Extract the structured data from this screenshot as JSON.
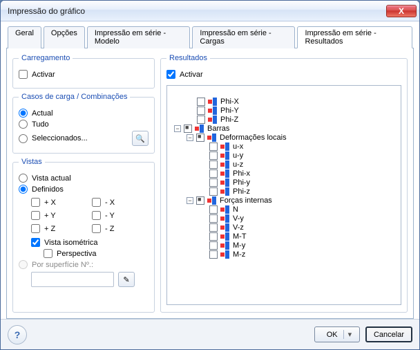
{
  "window": {
    "title": "Impressão do gráfico"
  },
  "close_icon": "X",
  "tabs": [
    {
      "label": "Geral"
    },
    {
      "label": "Opções"
    },
    {
      "label": "Impressão em série - Modelo"
    },
    {
      "label": "Impressão em série - Cargas"
    },
    {
      "label": "Impressão em série - Resultados"
    }
  ],
  "left": {
    "group_loading": "Carregamento",
    "activate_left": "Activar",
    "group_cases": "Casos de carga / Combinações",
    "case_actual": "Actual",
    "case_all": "Tudo",
    "case_selected": "Seleccionados...",
    "group_views": "Vistas",
    "view_current": "Vista actual",
    "view_defined": "Definidos",
    "dir_px": "+ X",
    "dir_nx": "- X",
    "dir_py": "+ Y",
    "dir_ny": "- Y",
    "dir_pz": "+ Z",
    "dir_nz": "- Z",
    "iso": "Vista isométrica",
    "perspective": "Perspectiva",
    "by_surface": "Por superfície Nº.:"
  },
  "right": {
    "group_results": "Resultados",
    "activate_right": "Activar",
    "tree": {
      "phix": "Phi-X",
      "phiy": "Phi-Y",
      "phiz": "Phi-Z",
      "barras": "Barras",
      "def_local": "Deformações locais",
      "ux": "u-x",
      "uy": "u-y",
      "uz": "u-z",
      "phix_l": "Phi-x",
      "phiy_l": "Phi-y",
      "phiz_l": "Phi-z",
      "forces": "Forças internas",
      "N": "N",
      "Vy": "V-y",
      "Vz": "V-z",
      "MT": "M-T",
      "My": "M-y",
      "Mz": "M-z"
    }
  },
  "footer": {
    "ok": "OK",
    "cancel": "Cancelar"
  }
}
